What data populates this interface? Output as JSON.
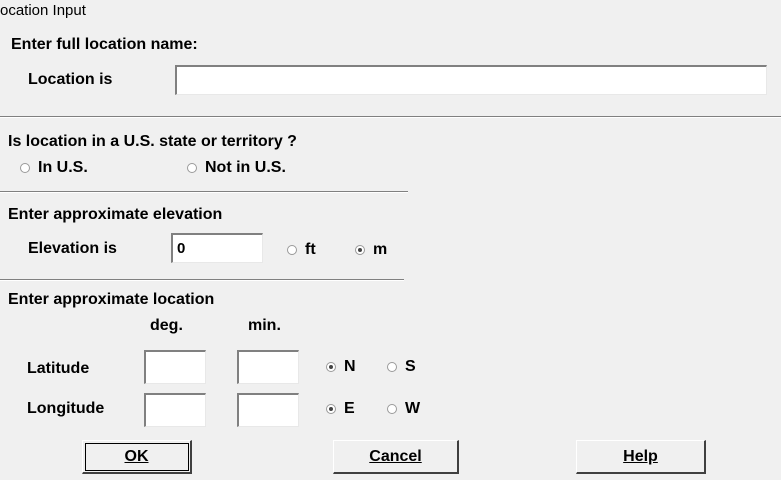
{
  "window": {
    "title": "ocation Input"
  },
  "location_name": {
    "heading": "Enter full location name:",
    "label": "Location is",
    "value": ""
  },
  "us_state": {
    "heading": "Is location in a U.S. state or territory ?",
    "options": [
      {
        "label": "In U.S.",
        "checked": false
      },
      {
        "label": "Not in U.S.",
        "checked": false
      }
    ]
  },
  "elevation": {
    "heading": "Enter approximate elevation",
    "label": "Elevation is",
    "value": "0",
    "units": [
      {
        "label": "ft",
        "checked": false
      },
      {
        "label": "m",
        "checked": true
      }
    ]
  },
  "coords": {
    "heading": "Enter approximate location",
    "col_deg": "deg.",
    "col_min": "min.",
    "latitude": {
      "label": "Latitude",
      "deg": "",
      "min": "",
      "hemis": [
        {
          "label": "N",
          "checked": true
        },
        {
          "label": "S",
          "checked": false
        }
      ]
    },
    "longitude": {
      "label": "Longitude",
      "deg": "",
      "min": "",
      "hemis": [
        {
          "label": "E",
          "checked": true
        },
        {
          "label": "W",
          "checked": false
        }
      ]
    }
  },
  "buttons": {
    "ok": "OK",
    "cancel": "Cancel",
    "help": "Help"
  }
}
